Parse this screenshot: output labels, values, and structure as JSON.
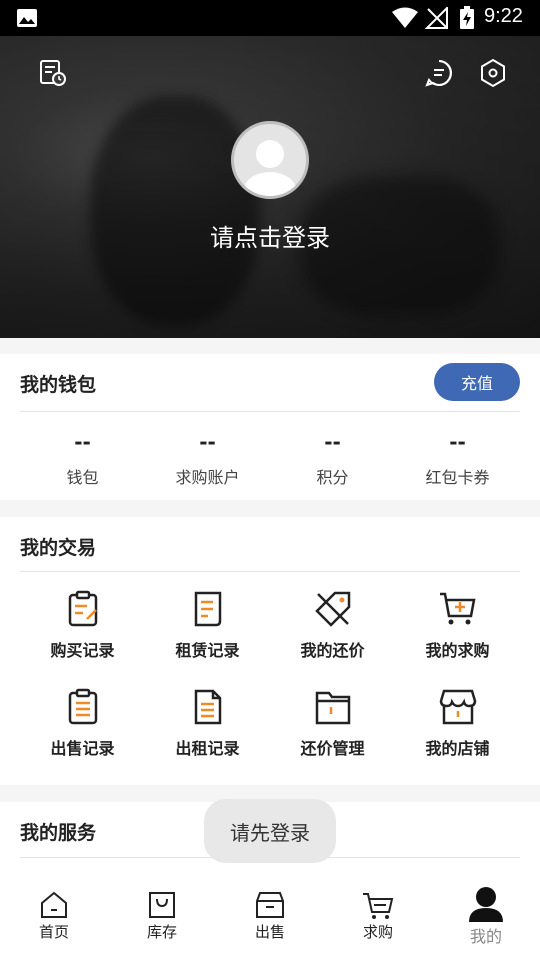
{
  "status_bar": {
    "time": "9:22"
  },
  "profile": {
    "login_prompt": "请点击登录"
  },
  "wallet": {
    "title": "我的钱包",
    "recharge_label": "充值",
    "stats": [
      {
        "value": "--",
        "label": "钱包"
      },
      {
        "value": "--",
        "label": "求购账户"
      },
      {
        "value": "--",
        "label": "积分"
      },
      {
        "value": "--",
        "label": "红包卡券"
      }
    ]
  },
  "trade": {
    "title": "我的交易",
    "items": [
      {
        "label": "购买记录",
        "icon": "purchase-record-icon"
      },
      {
        "label": "租赁记录",
        "icon": "lease-record-icon"
      },
      {
        "label": "我的还价",
        "icon": "price-tag-icon"
      },
      {
        "label": "我的求购",
        "icon": "cart-plus-icon"
      },
      {
        "label": "出售记录",
        "icon": "sale-record-icon"
      },
      {
        "label": "出租记录",
        "icon": "rent-out-record-icon"
      },
      {
        "label": "还价管理",
        "icon": "folder-icon"
      },
      {
        "label": "我的店铺",
        "icon": "store-icon"
      }
    ]
  },
  "service": {
    "title": "我的服务"
  },
  "toast": {
    "text": "请先登录"
  },
  "tabs": [
    {
      "label": "首页",
      "icon": "home-icon"
    },
    {
      "label": "库存",
      "icon": "bag-icon"
    },
    {
      "label": "出售",
      "icon": "box-icon"
    },
    {
      "label": "求购",
      "icon": "cart-icon"
    },
    {
      "label": "我的",
      "icon": "person-icon",
      "active": true
    }
  ],
  "colors": {
    "accent": "#3f69b4",
    "icon_orange": "#f08a24"
  }
}
